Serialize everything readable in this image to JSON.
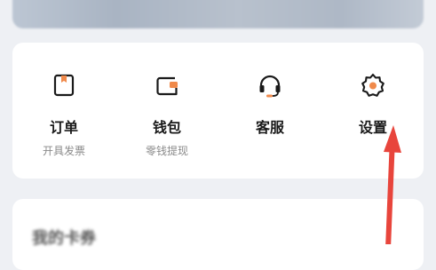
{
  "functions": [
    {
      "icon": "order-icon",
      "title": "订单",
      "subtitle": "开具发票"
    },
    {
      "icon": "wallet-icon",
      "title": "钱包",
      "subtitle": "零钱提现"
    },
    {
      "icon": "headset-icon",
      "title": "客服",
      "subtitle": ""
    },
    {
      "icon": "gear-icon",
      "title": "设置",
      "subtitle": ""
    }
  ],
  "favorites": {
    "title": "我的卡券"
  },
  "colors": {
    "accent": "#f08a4b",
    "arrow": "#e8453c",
    "icon_stroke": "#1a1a1a",
    "background": "#eef0f4",
    "card": "#ffffff"
  }
}
